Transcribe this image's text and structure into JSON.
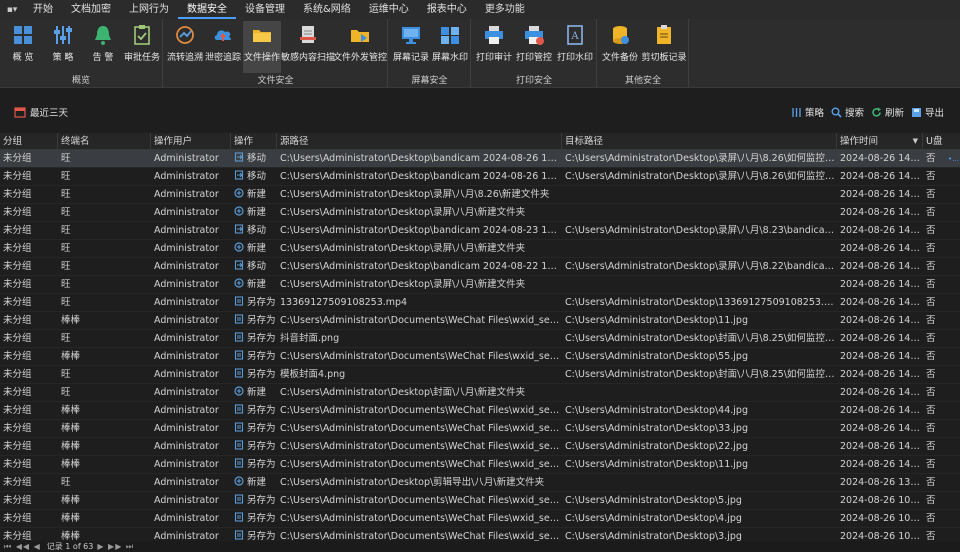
{
  "menu": {
    "system_glyph": "▪▾",
    "items": [
      "开始",
      "文档加密",
      "上网行为",
      "数据安全",
      "设备管理",
      "系统&网络",
      "运维中心",
      "报表中心",
      "更多功能"
    ],
    "active_index": 3
  },
  "ribbon": {
    "groups": [
      {
        "label": "概览",
        "buttons": [
          "概 览",
          "策 略",
          "告 警",
          "审批任务"
        ]
      },
      {
        "label": "文件安全",
        "buttons": [
          "流转追溯",
          "泄密追踪",
          "文件操作",
          "敏感内容扫描",
          "文件外发管控"
        ]
      },
      {
        "label": "屏幕安全",
        "buttons": [
          "屏幕记录",
          "屏幕水印"
        ]
      },
      {
        "label": "打印安全",
        "buttons": [
          "打印审计",
          "打印管控",
          "打印水印"
        ]
      },
      {
        "label": "其他安全",
        "buttons": [
          "文件备份",
          "剪切板记录"
        ]
      }
    ],
    "active_button": "文件操作"
  },
  "toolbar": {
    "range_label": "最近三天",
    "actions": [
      {
        "label": "策略",
        "icon": "strategy-icon"
      },
      {
        "label": "搜索",
        "icon": "search-icon"
      },
      {
        "label": "刷新",
        "icon": "refresh-icon"
      },
      {
        "label": "导出",
        "icon": "export-icon"
      }
    ]
  },
  "grid": {
    "columns": [
      "分组",
      "终端名",
      "操作用户",
      "操作",
      "源路径",
      "目标路径",
      "操作时间",
      "U盘"
    ],
    "rows": [
      [
        "未分组",
        "旺",
        "Administrator",
        "移动",
        "C:\\Users\\Administrator\\Desktop\\bandicam 2024-08-26 11-52-58-640....",
        "C:\\Users\\Administrator\\Desktop\\录屏\\八月\\8.26\\如何监控员工电脑？ 电...",
        "2024-08-26 14:32:55",
        "否"
      ],
      [
        "未分组",
        "旺",
        "Administrator",
        "移动",
        "C:\\Users\\Administrator\\Desktop\\bandicam 2024-08-26 11-22-33-935....",
        "C:\\Users\\Administrator\\Desktop\\录屏\\八月\\8.26\\如何监控员工电脑？ 电...",
        "2024-08-26 14:32:55",
        "否"
      ],
      [
        "未分组",
        "旺",
        "Administrator",
        "新建",
        "C:\\Users\\Administrator\\Desktop\\录屏\\八月\\8.26\\新建文件夹",
        "",
        "2024-08-26 14:32:47",
        "否"
      ],
      [
        "未分组",
        "旺",
        "Administrator",
        "新建",
        "C:\\Users\\Administrator\\Desktop\\录屏\\八月\\新建文件夹",
        "",
        "2024-08-26 14:32:43",
        "否"
      ],
      [
        "未分组",
        "旺",
        "Administrator",
        "移动",
        "C:\\Users\\Administrator\\Desktop\\bandicam 2024-08-23 16-27-04-839....",
        "C:\\Users\\Administrator\\Desktop\\录屏\\八月\\8.23\\bandicam 2024-08-2...",
        "2024-08-26 14:32:35",
        "否"
      ],
      [
        "未分组",
        "旺",
        "Administrator",
        "新建",
        "C:\\Users\\Administrator\\Desktop\\录屏\\八月\\新建文件夹",
        "",
        "2024-08-26 14:32:31",
        "否"
      ],
      [
        "未分组",
        "旺",
        "Administrator",
        "移动",
        "C:\\Users\\Administrator\\Desktop\\bandicam 2024-08-22 10-21-57-412....",
        "C:\\Users\\Administrator\\Desktop\\录屏\\八月\\8.22\\bandicam 2024-08-2...",
        "2024-08-26 14:32:25",
        "否"
      ],
      [
        "未分组",
        "旺",
        "Administrator",
        "新建",
        "C:\\Users\\Administrator\\Desktop\\录屏\\八月\\新建文件夹",
        "",
        "2024-08-26 14:32:22",
        "否"
      ],
      [
        "未分组",
        "旺",
        "Administrator",
        "另存为",
        "13369127509108253.mp4",
        "C:\\Users\\Administrator\\Desktop\\13369127509108253.mp4",
        "2024-08-26 14:31:52",
        "否"
      ],
      [
        "未分组",
        "棒棒",
        "Administrator",
        "另存为",
        "C:\\Users\\Administrator\\Documents\\WeChat Files\\wxid_sezkh7ebyzls22\\...",
        "C:\\Users\\Administrator\\Desktop\\11.jpg",
        "2024-08-26 14:10:50",
        "否"
      ],
      [
        "未分组",
        "旺",
        "Administrator",
        "另存为",
        "抖音封面.png",
        "C:\\Users\\Administrator\\Desktop\\封面\\八月\\8.25\\如何监控员工电脑？ 电...",
        "2024-08-26 14:09:24",
        "否"
      ],
      [
        "未分组",
        "棒棒",
        "Administrator",
        "另存为",
        "C:\\Users\\Administrator\\Documents\\WeChat Files\\wxid_sezkh7ebyzls22\\...",
        "C:\\Users\\Administrator\\Desktop\\55.jpg",
        "2024-08-26 14:05:43",
        "否"
      ],
      [
        "未分组",
        "旺",
        "Administrator",
        "另存为",
        "模板封面4.png",
        "C:\\Users\\Administrator\\Desktop\\封面\\八月\\8.25\\如何监控员工电脑？ 电...",
        "2024-08-26 14:05:40",
        "否"
      ],
      [
        "未分组",
        "旺",
        "Administrator",
        "新建",
        "C:\\Users\\Administrator\\Desktop\\封面\\八月\\新建文件夹",
        "",
        "2024-08-26 14:05:35",
        "否"
      ],
      [
        "未分组",
        "棒棒",
        "Administrator",
        "另存为",
        "C:\\Users\\Administrator\\Documents\\WeChat Files\\wxid_sezkh7ebyzls22\\...",
        "C:\\Users\\Administrator\\Desktop\\44.jpg",
        "2024-08-26 14:04:54",
        "否"
      ],
      [
        "未分组",
        "棒棒",
        "Administrator",
        "另存为",
        "C:\\Users\\Administrator\\Documents\\WeChat Files\\wxid_sezkh7ebyzls22\\...",
        "C:\\Users\\Administrator\\Desktop\\33.jpg",
        "2024-08-26 14:03:27",
        "否"
      ],
      [
        "未分组",
        "棒棒",
        "Administrator",
        "另存为",
        "C:\\Users\\Administrator\\Documents\\WeChat Files\\wxid_sezkh7ebyzls22\\...",
        "C:\\Users\\Administrator\\Desktop\\22.jpg",
        "2024-08-26 14:02:13",
        "否"
      ],
      [
        "未分组",
        "棒棒",
        "Administrator",
        "另存为",
        "C:\\Users\\Administrator\\Documents\\WeChat Files\\wxid_sezkh7ebyzls22\\...",
        "C:\\Users\\Administrator\\Desktop\\11.jpg",
        "2024-08-26 14:00:49",
        "否"
      ],
      [
        "未分组",
        "旺",
        "Administrator",
        "新建",
        "C:\\Users\\Administrator\\Desktop\\剪辑导出\\八月\\新建文件夹",
        "",
        "2024-08-26 13:53:51",
        "否"
      ],
      [
        "未分组",
        "棒棒",
        "Administrator",
        "另存为",
        "C:\\Users\\Administrator\\Documents\\WeChat Files\\wxid_sezkh7ebyzls22\\...",
        "C:\\Users\\Administrator\\Desktop\\5.jpg",
        "2024-08-26 10:28:49",
        "否"
      ],
      [
        "未分组",
        "棒棒",
        "Administrator",
        "另存为",
        "C:\\Users\\Administrator\\Documents\\WeChat Files\\wxid_sezkh7ebyzls22\\...",
        "C:\\Users\\Administrator\\Desktop\\4.jpg",
        "2024-08-26 10:27:32",
        "否"
      ],
      [
        "未分组",
        "棒棒",
        "Administrator",
        "另存为",
        "C:\\Users\\Administrator\\Documents\\WeChat Files\\wxid_sezkh7ebyzls22\\...",
        "C:\\Users\\Administrator\\Desktop\\3.jpg",
        "2024-08-26 10:25:36",
        "否"
      ]
    ],
    "selected_row": 0,
    "sort_glyph": "▼",
    "row_more_glyph": "•••"
  },
  "status": {
    "nav_glyphs": "⏮ ◀◀ ◀",
    "nav_glyphs_right": "▶ ▶▶ ⏭",
    "record_text": "记录 1 of 63"
  },
  "colors": {
    "accent": "#4a9eff",
    "move_icon": "#5b9bd5",
    "new_icon": "#5b9bd5",
    "saveas_icon": "#5b9bd5"
  }
}
